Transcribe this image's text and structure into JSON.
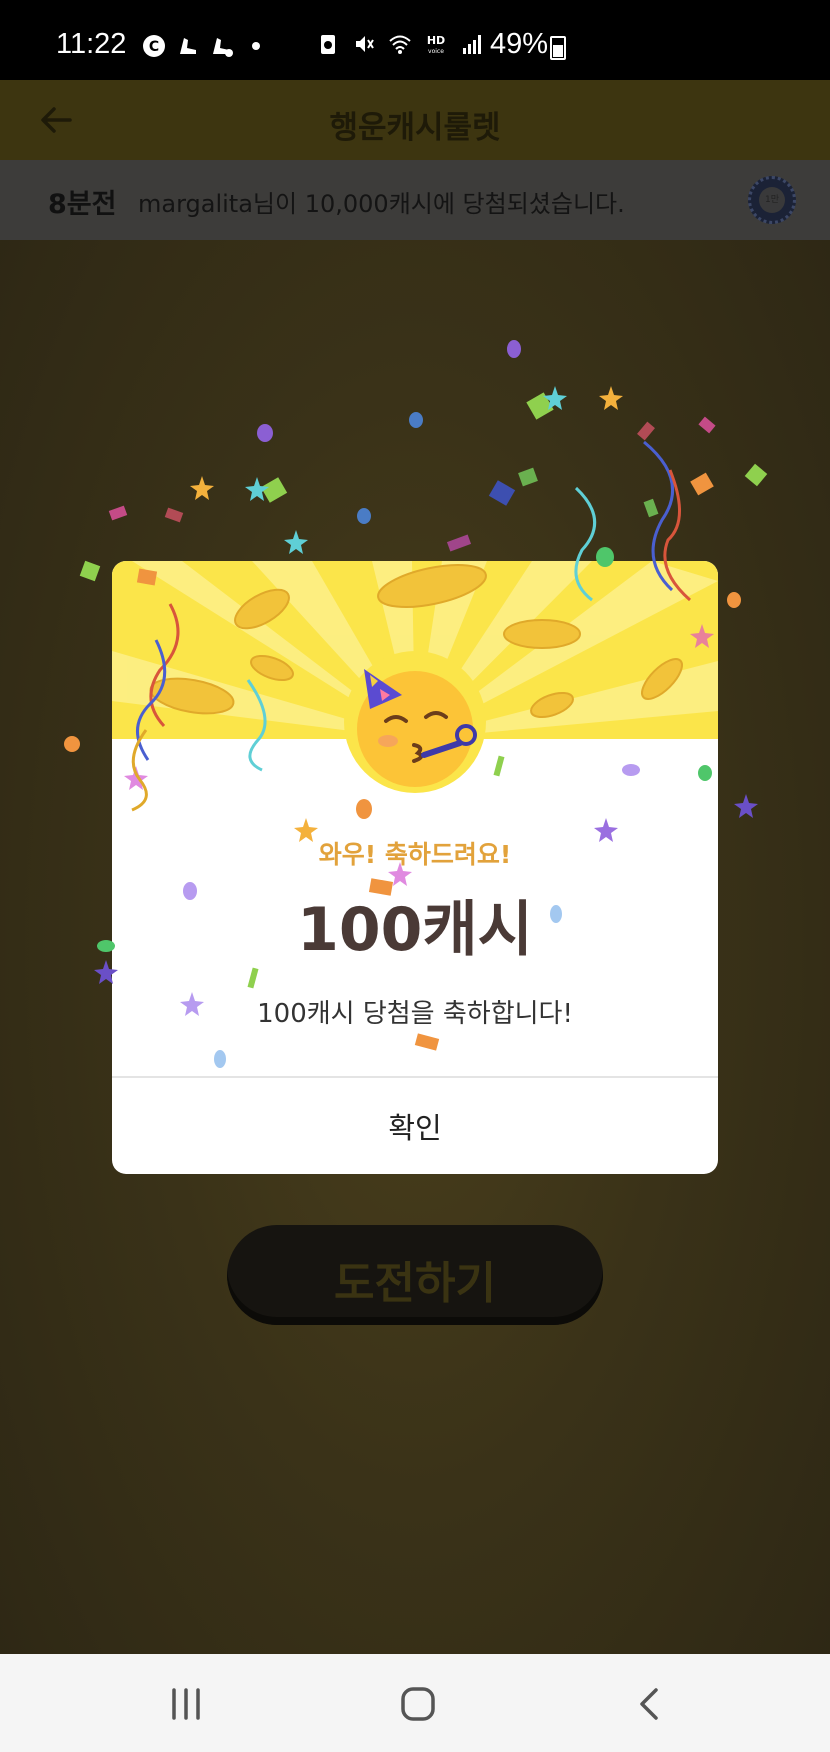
{
  "status_bar": {
    "time": "11:22",
    "battery": "49%"
  },
  "app_bar": {
    "title": "행운캐시룰렛"
  },
  "ticker": {
    "time_ago": "8분전",
    "message": "margalita님이 10,000캐시에 당첨되셨습니다.",
    "coin_label": "1만"
  },
  "challenge_button": {
    "label": "도전하기"
  },
  "modal": {
    "headline": "와우! 축하드려요!",
    "amount": "100캐시",
    "description": "100캐시 당첨을 축하합니다!",
    "confirm_label": "확인"
  },
  "colors": {
    "banner_yellow": "#fbe54a",
    "headline_orange": "#e2a23b",
    "amount_text": "#4a3a36"
  },
  "icons": {
    "back": "arrow-left-icon",
    "nav_recent": "recent-apps-icon",
    "nav_home": "home-icon",
    "nav_back": "nav-back-icon"
  }
}
